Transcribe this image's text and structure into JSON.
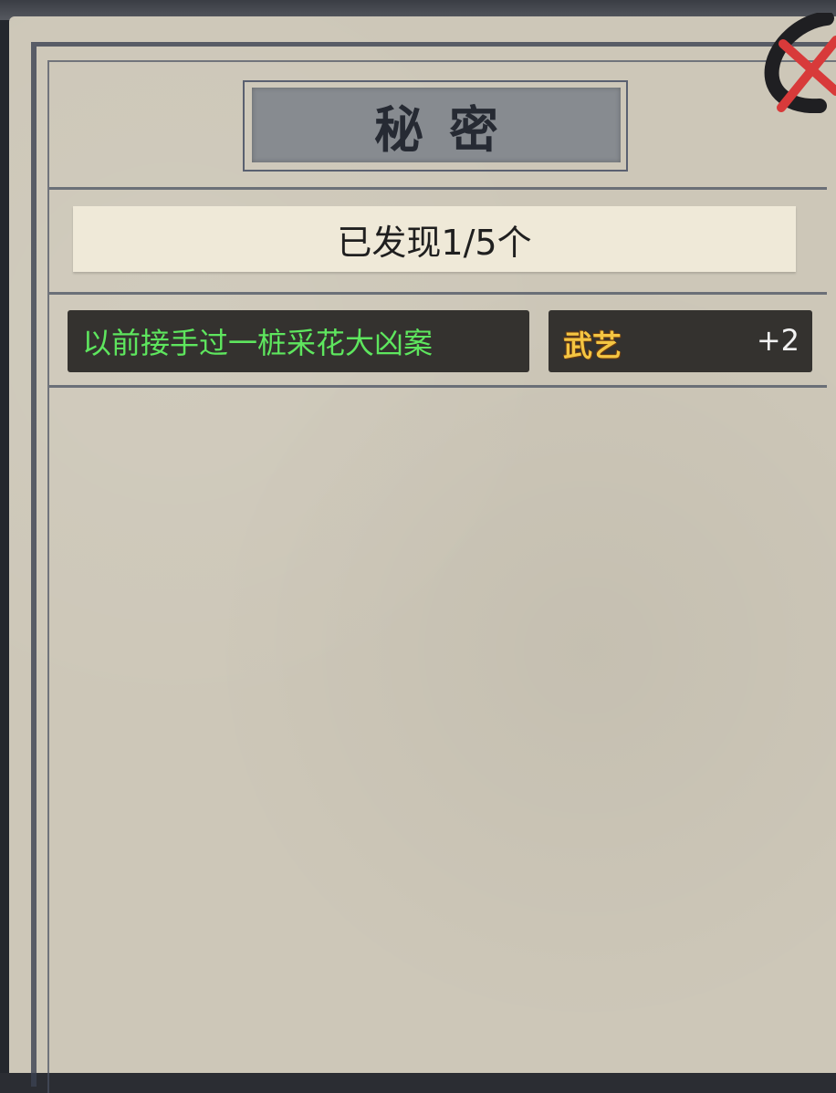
{
  "panel": {
    "title": "秘密"
  },
  "counter": {
    "text": "已发现1/5个"
  },
  "secrets": [
    {
      "text": "以前接手过一桩采花大凶案",
      "reward_label": "武艺",
      "reward_value": "+2"
    }
  ],
  "colors": {
    "secret_text": "#5ee65e",
    "reward_label": "#f4c542",
    "close_x": "#d83a3a"
  },
  "icons": {
    "close": "close-icon"
  }
}
